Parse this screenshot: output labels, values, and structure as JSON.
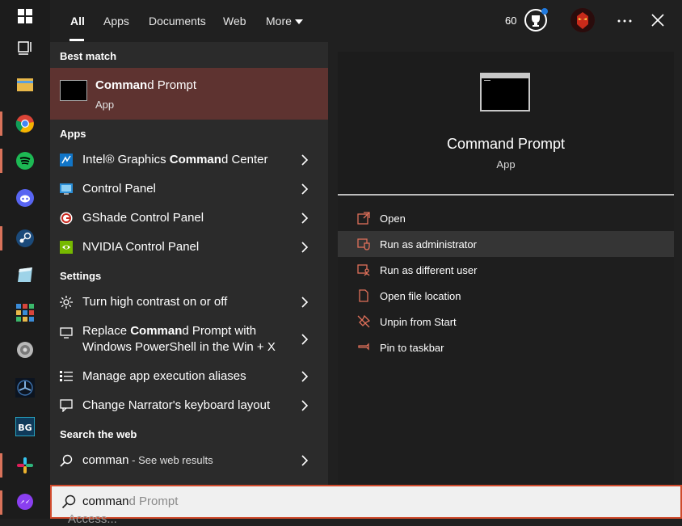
{
  "tabs": {
    "all": "All",
    "apps": "Apps",
    "documents": "Documents",
    "web": "Web",
    "more": "More"
  },
  "header": {
    "points": "60"
  },
  "sections": {
    "best_match": "Best match",
    "apps": "Apps",
    "settings": "Settings",
    "search_web": "Search the web"
  },
  "best": {
    "title_bold": "Comman",
    "title_rest": "d Prompt",
    "subtitle": "App"
  },
  "apps": [
    {
      "pre": "Intel® Graphics ",
      "bold": "Comman",
      "post": "d Center"
    },
    {
      "label": "Control Panel"
    },
    {
      "label": "GShade Control Panel"
    },
    {
      "label": "NVIDIA Control Panel"
    }
  ],
  "settings": [
    {
      "label": "Turn high contrast on or off"
    },
    {
      "pre": "Replace ",
      "bold": "Comman",
      "post": "d Prompt with",
      "line2": "Windows PowerShell in the Win + X"
    },
    {
      "label": "Manage app execution aliases"
    },
    {
      "label": "Change Narrator's keyboard layout"
    }
  ],
  "web": {
    "query": "comman",
    "suffix": " - See web results"
  },
  "detail": {
    "title": "Command Prompt",
    "subtitle": "App"
  },
  "actions": [
    "Open",
    "Run as administrator",
    "Run as different user",
    "Open file location",
    "Unpin from Start",
    "Pin to taskbar"
  ],
  "search": {
    "typed": "comman",
    "suggest": "d Prompt",
    "below": "Access..."
  }
}
